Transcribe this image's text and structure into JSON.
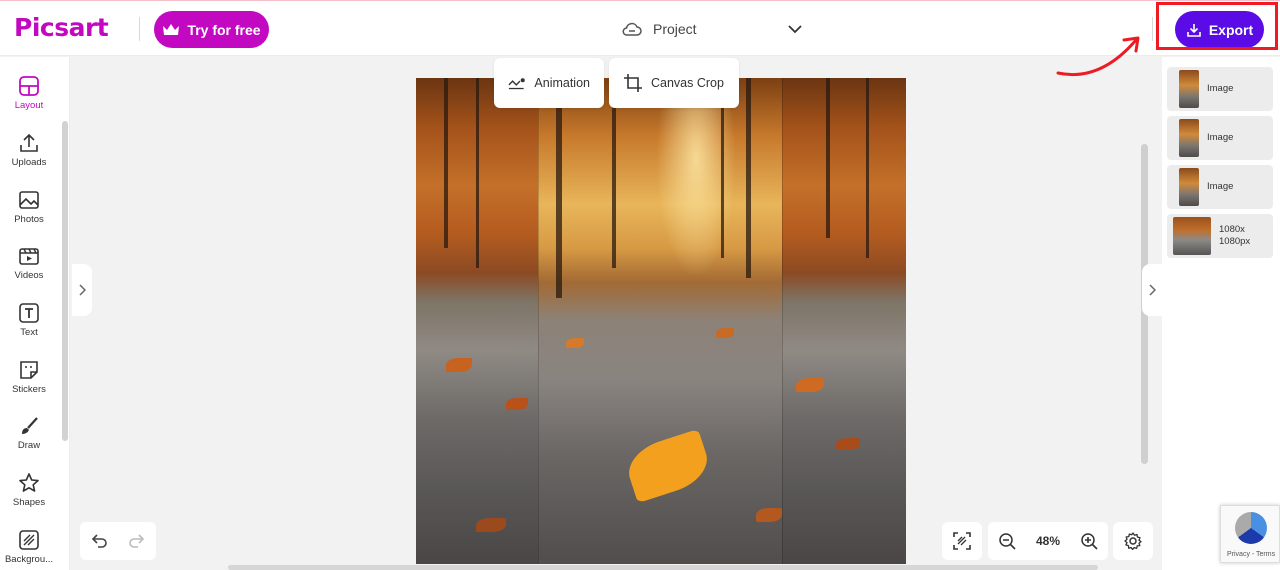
{
  "topbar": {
    "logo_text": "Picsart",
    "try_label": "Try for free",
    "project_label": "Project",
    "export_label": "Export"
  },
  "sidebar": {
    "items": [
      {
        "label": "Layout",
        "icon": "layout-icon",
        "active": true
      },
      {
        "label": "Uploads",
        "icon": "upload-icon"
      },
      {
        "label": "Photos",
        "icon": "photo-icon"
      },
      {
        "label": "Videos",
        "icon": "video-icon"
      },
      {
        "label": "Text",
        "icon": "text-icon"
      },
      {
        "label": "Stickers",
        "icon": "sticker-icon"
      },
      {
        "label": "Draw",
        "icon": "brush-icon"
      },
      {
        "label": "Shapes",
        "icon": "star-icon"
      },
      {
        "label": "Backgrou...",
        "icon": "background-icon"
      }
    ]
  },
  "canvas": {
    "animation_label": "Animation",
    "crop_label": "Canvas Crop",
    "zoom_value": "48%"
  },
  "layers": {
    "items": [
      {
        "label": "Image"
      },
      {
        "label": "Image"
      },
      {
        "label": "Image"
      },
      {
        "label": "1080x 1080px"
      }
    ]
  },
  "recaptcha": {
    "text": "Privacy - Terms"
  },
  "colors": {
    "brand": "#c209c1",
    "export": "#5a0be6",
    "highlight": "#ee1b24"
  }
}
